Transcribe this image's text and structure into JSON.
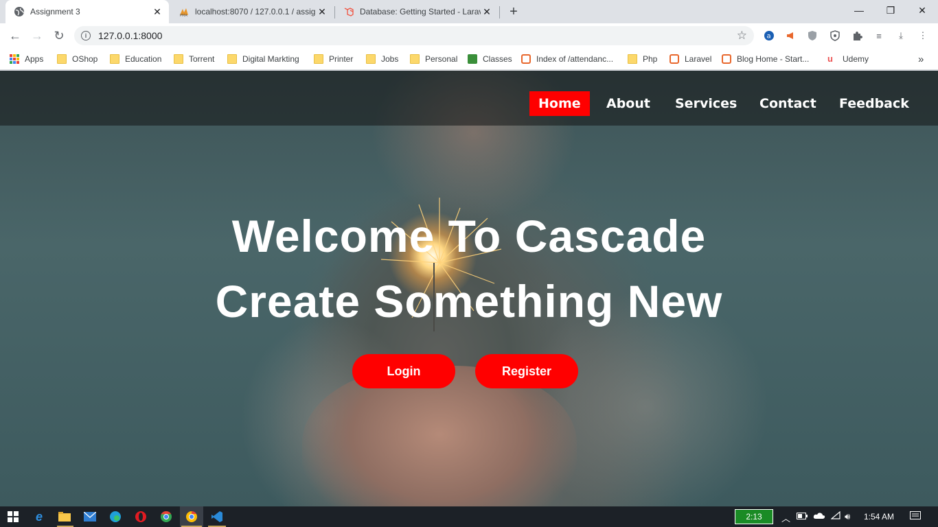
{
  "browser": {
    "tabs": [
      {
        "title": "Assignment 3",
        "icon": "globe-icon",
        "active": true
      },
      {
        "title": "localhost:8070 / 127.0.0.1 / assig",
        "icon": "phpmyadmin-icon",
        "active": false
      },
      {
        "title": "Database: Getting Started - Larav",
        "icon": "laravel-icon",
        "active": false
      }
    ],
    "url": "127.0.0.1:8000",
    "bookmarks": [
      {
        "label": "Apps",
        "icon": "apps-grid-icon"
      },
      {
        "label": "OShop",
        "icon": "folder-icon"
      },
      {
        "label": "Education",
        "icon": "folder-icon"
      },
      {
        "label": "Torrent",
        "icon": "folder-icon"
      },
      {
        "label": "Digital Markting",
        "icon": "folder-icon"
      },
      {
        "label": "Printer",
        "icon": "folder-icon"
      },
      {
        "label": "Jobs",
        "icon": "folder-icon"
      },
      {
        "label": "Personal",
        "icon": "folder-icon"
      },
      {
        "label": "Classes",
        "icon": "classroom-icon"
      },
      {
        "label": "Index of /attendanc...",
        "icon": "xampp-icon"
      },
      {
        "label": "Php",
        "icon": "folder-icon"
      },
      {
        "label": "Laravel",
        "icon": "xampp-icon"
      },
      {
        "label": "Blog Home - Start...",
        "icon": "xampp-icon"
      },
      {
        "label": "Udemy",
        "icon": "udemy-icon"
      }
    ],
    "more_bookmarks": "»"
  },
  "site": {
    "nav": [
      {
        "label": "Home",
        "active": true
      },
      {
        "label": "About",
        "active": false
      },
      {
        "label": "Services",
        "active": false
      },
      {
        "label": "Contact",
        "active": false
      },
      {
        "label": "Feedback",
        "active": false
      }
    ],
    "hero_line1": "Welcome To Cascade",
    "hero_line2": "Create Something New",
    "login_label": "Login",
    "register_label": "Register",
    "accent_color": "#ff0000"
  },
  "taskbar": {
    "battery_time": "2:13",
    "clock": "1:54 AM"
  }
}
